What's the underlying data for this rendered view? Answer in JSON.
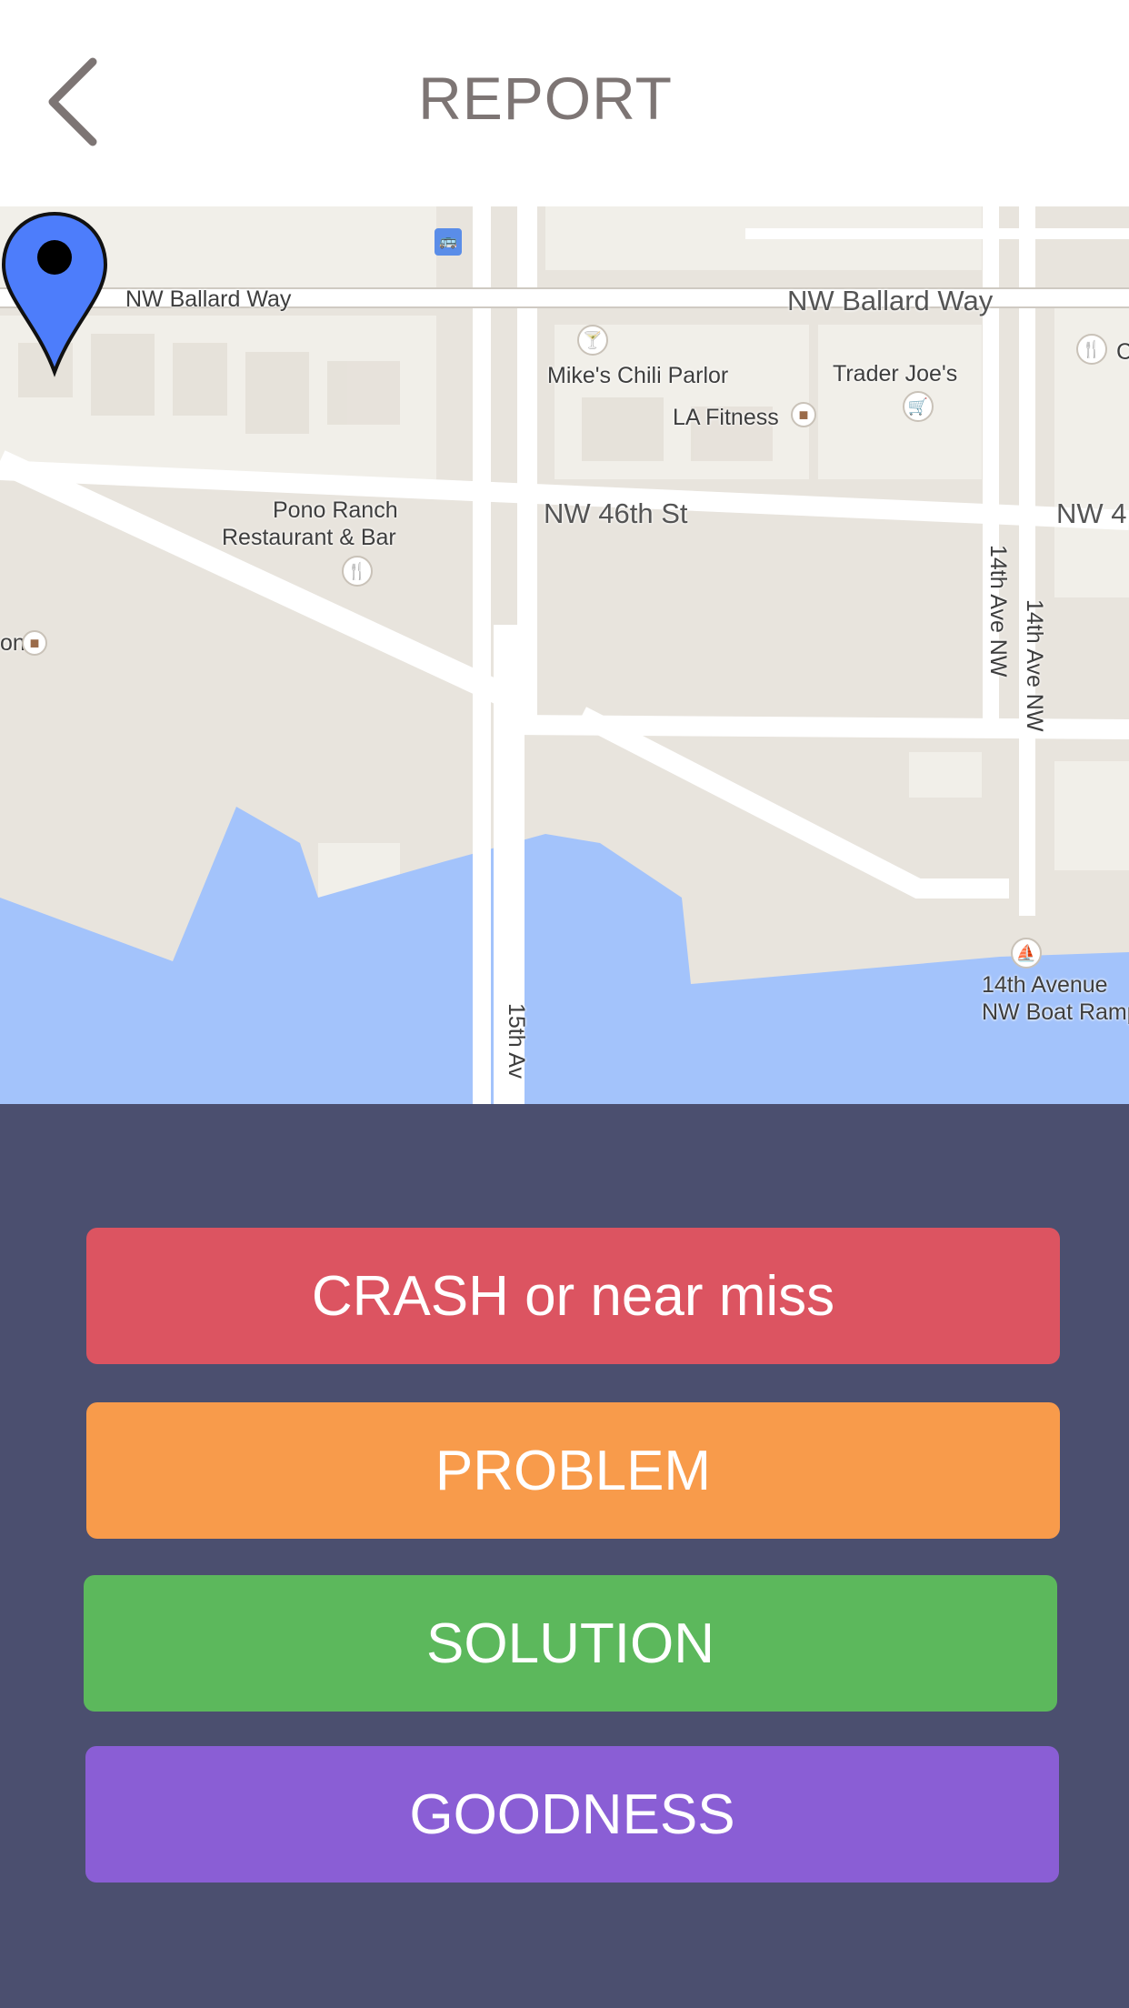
{
  "header": {
    "title": "REPORT",
    "back_icon": "chevron-left-icon"
  },
  "map": {
    "labels": {
      "nw_ballard_way_west": "NW Ballard Way",
      "nw_ballard_way_east": "NW Ballard Way",
      "mikes_chili_parlor": "Mike's Chili Parlor",
      "trader_joes": "Trader Joe's",
      "la_fitness": "LA Fitness",
      "pono_ranch_1": "Pono Ranch",
      "pono_ranch_2": "Restaurant & Bar",
      "nw_46th_st": "NW 46th St",
      "nw_46th_edge": "NW 4",
      "edge_on": "on",
      "edge_c": "C",
      "ave14_a": "14th Ave NW",
      "ave14_b": "14th Ave NW",
      "ave15": "15th Av",
      "boat_ramp_1": "14th Avenue",
      "boat_ramp_2": "NW Boat Ramp"
    },
    "pin_icon": "map-pin-icon"
  },
  "actions": [
    {
      "label": "CRASH or near miss",
      "color": "#dc5461"
    },
    {
      "label": "PROBLEM",
      "color": "#f89b4b"
    },
    {
      "label": "SOLUTION",
      "color": "#5cb85c"
    },
    {
      "label": "GOODNESS",
      "color": "#8a5ed5"
    }
  ]
}
